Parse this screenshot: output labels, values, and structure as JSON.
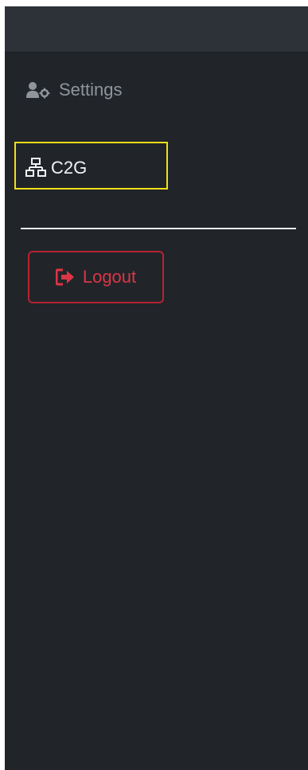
{
  "sidebar": {
    "items": [
      {
        "label": "Settings",
        "icon": "users-cog-icon"
      },
      {
        "label": "C2G",
        "icon": "network-icon"
      }
    ]
  },
  "logout": {
    "label": "Logout",
    "icon": "sign-out-icon"
  },
  "colors": {
    "background": "#212529",
    "topbar": "#2d3238",
    "muted_text": "#8f959b",
    "active_text": "#f2f3f4",
    "highlight": "#f2df18",
    "danger": "#dc3545"
  }
}
